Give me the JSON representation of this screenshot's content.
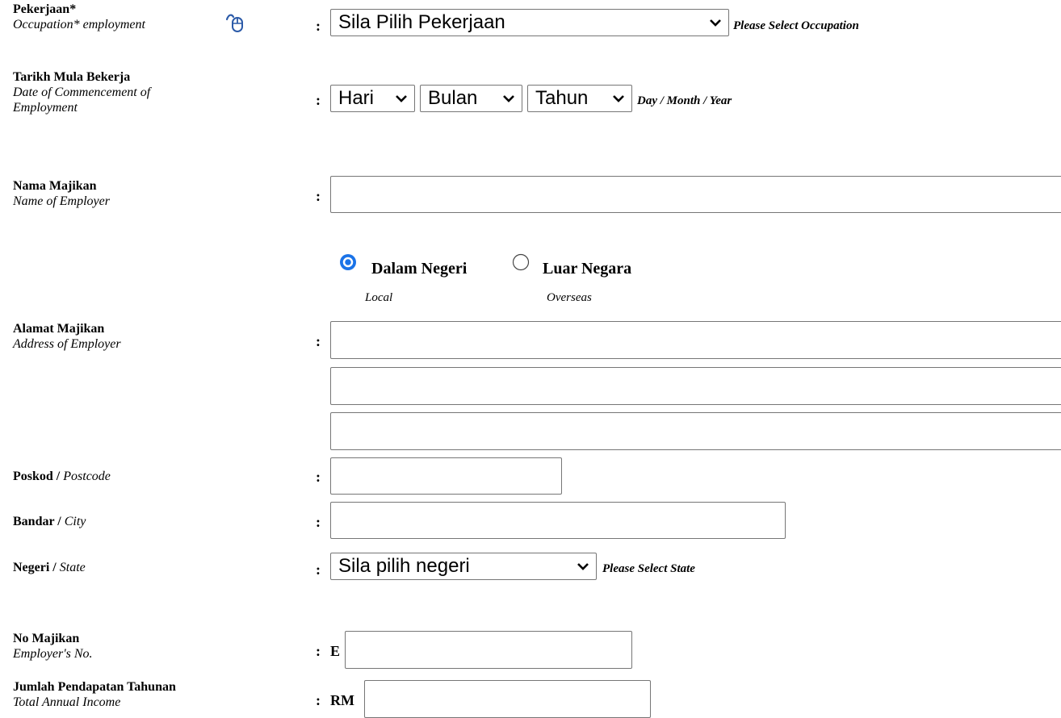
{
  "occupation": {
    "label_ms": "Pekerjaan*",
    "label_en": "Occupation* employment",
    "select_value": "Sila Pilih Pekerjaan",
    "hint": "Please Select Occupation",
    "icon": "mouse-pointer-icon"
  },
  "commencement": {
    "label_ms": "Tarikh Mula Bekerja",
    "label_en_line1": "Date of Commencement of",
    "label_en_line2": "Employment",
    "day": "Hari",
    "month": "Bulan",
    "year": "Tahun",
    "hint": "Day / Month / Year"
  },
  "employer_name": {
    "label_ms": "Nama Majikan",
    "label_en": "Name of Employer",
    "value": ""
  },
  "location": {
    "local_label": "Dalam Negeri",
    "local_sub": "Local",
    "overseas_label": "Luar Negara",
    "overseas_sub": "Overseas",
    "selected": "local",
    "accent": "#1a73e8"
  },
  "employer_address": {
    "label_ms": "Alamat Majikan",
    "label_en": "Address of Employer",
    "line1": "",
    "line2": "",
    "line3": ""
  },
  "postcode": {
    "label_ms": "Poskod /",
    "label_en": "Postcode",
    "value": ""
  },
  "city": {
    "label_ms": "Bandar /",
    "label_en": "City",
    "value": ""
  },
  "state": {
    "label_ms": "Negeri /",
    "label_en": "State",
    "select_value": "Sila pilih negeri",
    "hint": "Please Select State"
  },
  "employer_no": {
    "label_ms": "No Majikan",
    "label_en": "Employer's No.",
    "prefix": "E",
    "value": ""
  },
  "annual_income": {
    "label_ms": "Jumlah Pendapatan Tahunan",
    "label_en": "Total Annual Income",
    "prefix": "RM",
    "value": ""
  },
  "colon": ":"
}
